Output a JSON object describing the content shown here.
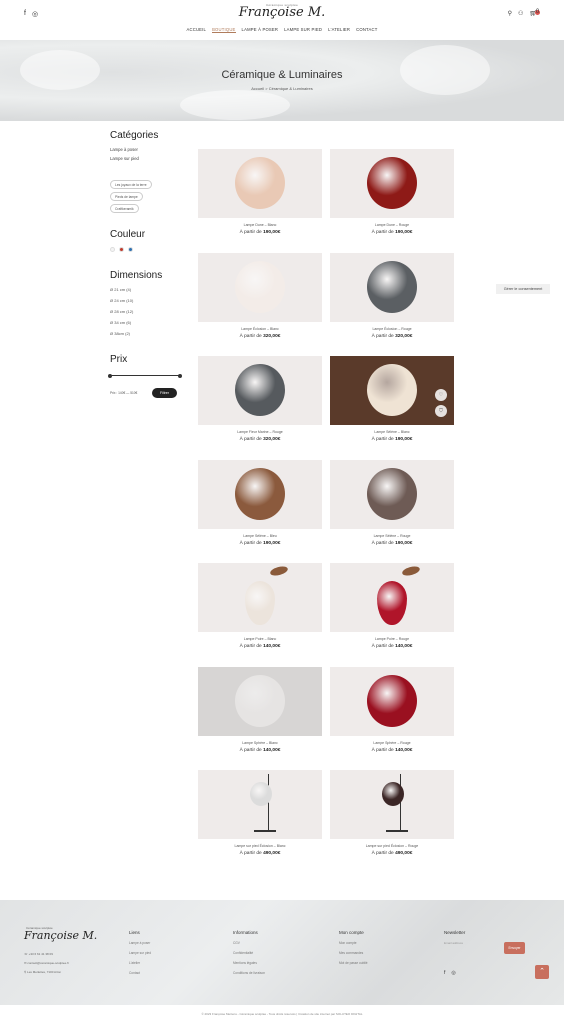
{
  "header": {
    "logo_small": "Céramique sculptée",
    "logo": "Françoise M.",
    "nav": [
      "ACCUEIL",
      "BOUTIQUE",
      "LAMPE À POSER",
      "LAMPE SUR PIED",
      "L'ATELIER",
      "CONTACT"
    ],
    "cart_count": "0"
  },
  "hero": {
    "title": "Céramique & Luminaires",
    "breadcrumb": "Accueil  >  Céramique & Luminaires"
  },
  "sidebar": {
    "categories_title": "Catégories",
    "categories": [
      "Lampe à poser",
      "Lampe sur pied"
    ],
    "chips": [
      "Les joyaux de la terre",
      "Pieds de lampe",
      "Craftkeramik"
    ],
    "color_title": "Couleur",
    "colors": [
      "#f4f4f4",
      "#c0392b",
      "#2c6fb0"
    ],
    "dimensions_title": "Dimensions",
    "dimensions": [
      "Ø 21 cm (4)",
      "Ø 24 cm (10)",
      "Ø 28 cm (12)",
      "Ø 34 cm (6)",
      "Ø 38cm (2)"
    ],
    "price_title": "Prix",
    "price_range": "Prix : 140€ — 510€",
    "filter_label": "Filtrer"
  },
  "products": [
    {
      "name": "Lampe Dune – Blanc",
      "price_prefix": "À partir de",
      "price": "190,00€",
      "color": "#e9c9b5",
      "bg": "#efebea"
    },
    {
      "name": "Lampe Dune – Rouge",
      "price_prefix": "À partir de",
      "price": "190,00€",
      "color": "#8e1a17",
      "bg": "#efebea"
    },
    {
      "name": "Lampe Éclosion – Blanc",
      "price_prefix": "À partir de",
      "price": "320,00€",
      "color": "#f3ece8",
      "bg": "#efebea"
    },
    {
      "name": "Lampe Éclosion – Rouge",
      "price_prefix": "À partir de",
      "price": "320,00€",
      "color": "#5b5f63",
      "bg": "#efebea"
    },
    {
      "name": "Lampe Fleur Marine – Rouge",
      "price_prefix": "À partir de",
      "price": "320,00€",
      "color": "#565a5e",
      "bg": "#efebea"
    },
    {
      "name": "Lampe Sélène – Blanc",
      "price_prefix": "À partir de",
      "price": "190,00€",
      "color": "#efe3d4",
      "bg": "#5a3a2a"
    },
    {
      "name": "Lampe Sélène – Bleu",
      "price_prefix": "À partir de",
      "price": "190,00€",
      "color": "#8b5a3d",
      "bg": "#efebea"
    },
    {
      "name": "Lampe Sélène – Rouge",
      "price_prefix": "À partir de",
      "price": "190,00€",
      "color": "#6e5b55",
      "bg": "#efebea"
    },
    {
      "name": "Lampe Poire – Blanc",
      "price_prefix": "À partir de",
      "price": "140,00€",
      "color": "#ece4dc",
      "bg": "#efebea"
    },
    {
      "name": "Lampe Poire – Rouge",
      "price_prefix": "À partir de",
      "price": "140,00€",
      "color": "#b0152a",
      "bg": "#efebea"
    },
    {
      "name": "Lampe Sphère – Blanc",
      "price_prefix": "À partir de",
      "price": "140,00€",
      "color": "#e6e4e3",
      "bg": "#d7d5d4"
    },
    {
      "name": "Lampe Sphère – Rouge",
      "price_prefix": "À partir de",
      "price": "140,00€",
      "color": "#9a1020",
      "bg": "#efebea"
    },
    {
      "name": "Lampe sur pied Éclosion – Blanc",
      "price_prefix": "À partir de",
      "price": "490,00€",
      "color": "#dcdcdc",
      "bg": "#efebea"
    },
    {
      "name": "Lampe sur pied Éclosion – Rouge",
      "price_prefix": "À partir de",
      "price": "490,00€",
      "color": "#3b2626",
      "bg": "#efebea"
    }
  ],
  "consent_label": "Gérer le consentement",
  "footer": {
    "logo_small": "Céramique sculptée",
    "logo": "Françoise M.",
    "contact": [
      "+33 6 61 41 38 09",
      "contact@ceramique-sculptee.fr",
      "Les Merlettes, 7100 Arlon"
    ],
    "columns": [
      {
        "title": "Liens",
        "items": [
          "Lampe à poser",
          "Lampe sur pied",
          "L'atelier",
          "Contact"
        ]
      },
      {
        "title": "Informations",
        "items": [
          "CGV",
          "Confidentialité",
          "Mentions légales",
          "Conditions de livraison"
        ]
      },
      {
        "title": "Mon compte",
        "items": [
          "Mon compte",
          "Mes commandes",
          "Mot de passe oublié"
        ]
      }
    ],
    "newsletter_title": "Newsletter",
    "newsletter_placeholder": "Email address",
    "newsletter_button": "Envoyer",
    "copyright": "© 2023 Françoise Mertens - Céramique sculptée - Tous droits réservés | Création de site internet par SOLUTEO DIGITAL"
  }
}
